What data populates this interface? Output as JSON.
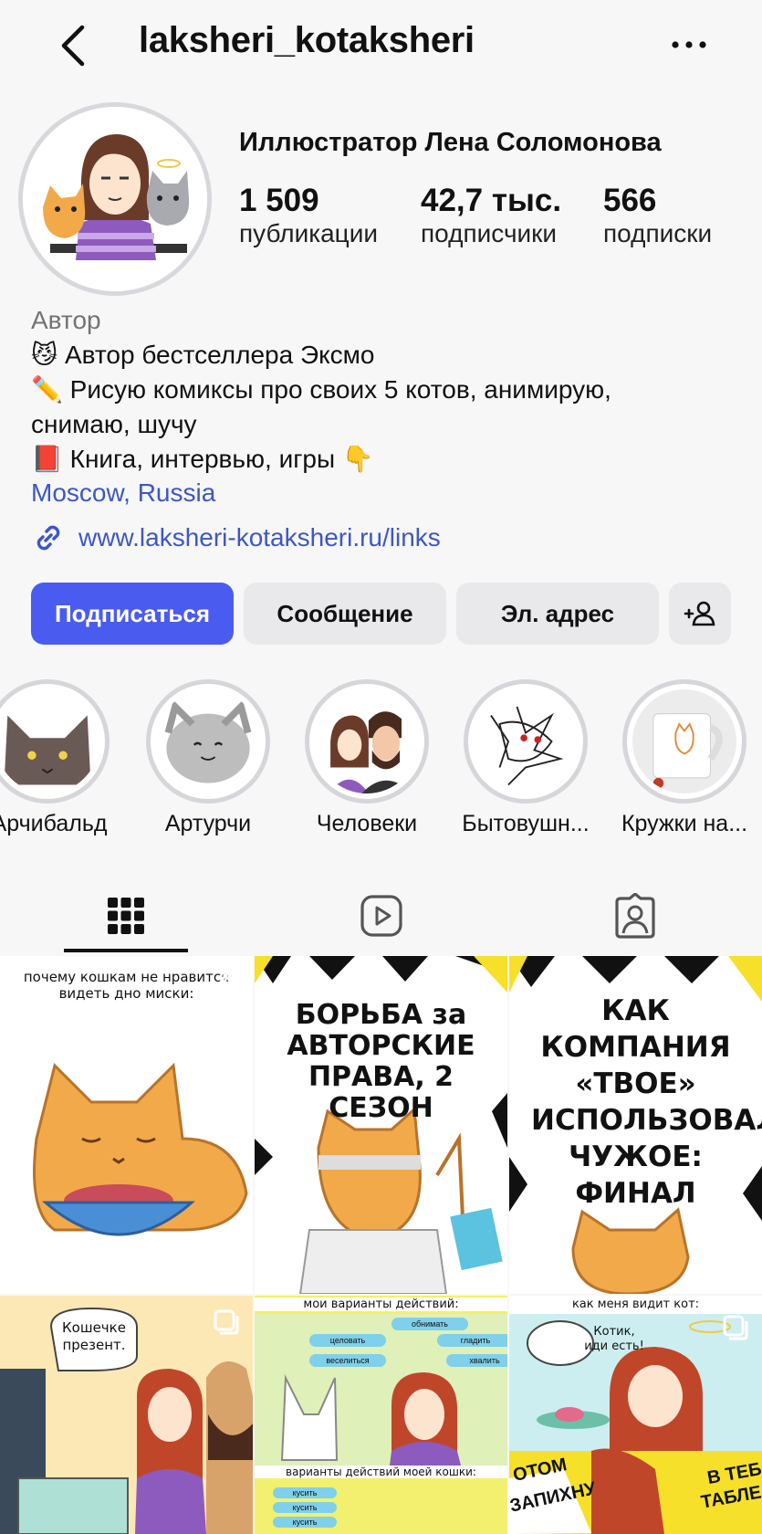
{
  "header": {
    "username": "laksheri_kotaksheri"
  },
  "profile": {
    "full_name": "Иллюстратор Лена Соломонова",
    "stats": [
      {
        "value": "1 509",
        "label": "публикации"
      },
      {
        "value": "42,7 тыс.",
        "label": "подписчики"
      },
      {
        "value": "566",
        "label": "подписки"
      }
    ],
    "category": "Автор",
    "bio_lines": [
      "😼 Автор бестселлера Эксмо",
      "✏️ Рисую комиксы про своих 5 котов, анимирую,",
      "снимаю, шучу",
      "📕 Книга, интервью, игры 👇"
    ],
    "location": "Moscow, Russia",
    "link": "www.laksheri-kotaksheri.ru/links"
  },
  "actions": {
    "follow": "Подписаться",
    "message": "Сообщение",
    "email": "Эл. адрес"
  },
  "highlights": [
    {
      "label": "Арчибальд"
    },
    {
      "label": "Артурчи"
    },
    {
      "label": "Человеки"
    },
    {
      "label": "Бытовушн..."
    },
    {
      "label": "Кружки на..."
    }
  ],
  "tabs": [
    "grid",
    "reels",
    "tagged"
  ],
  "posts": [
    {
      "caption": "почему кошкам не нравится видеть дно миски:"
    },
    {
      "caption": "БОРЬБА за АВТОРСКИЕ ПРАВА, 2 СЕЗОН"
    },
    {
      "caption": "КАК КОМПАНИЯ «ТВОЕ» ИСПОЛЬЗОВАЛА ЧУЖОЕ: ФИНАЛ"
    },
    {
      "caption": "Кошечке презент."
    },
    {
      "caption": "мои варианты действий:",
      "caption2": "варианты действий моей кошки:"
    },
    {
      "caption": "как меня видит кот:",
      "bubble": "Котик, иди есть!"
    }
  ],
  "post5_buttons": [
    "обнимать",
    "целовать",
    "гладить",
    "веселиться",
    "хвалить",
    "кусить",
    "кусить",
    "кусить"
  ],
  "post6_bottom": [
    "ОТОМ",
    "ЗАПИХНУ",
    "В ТЕБ",
    "ТАБЛЕ"
  ],
  "colors": {
    "accent": "#4a5cf0",
    "link": "#3d57c6",
    "cat_orange": "#f2a94a"
  }
}
